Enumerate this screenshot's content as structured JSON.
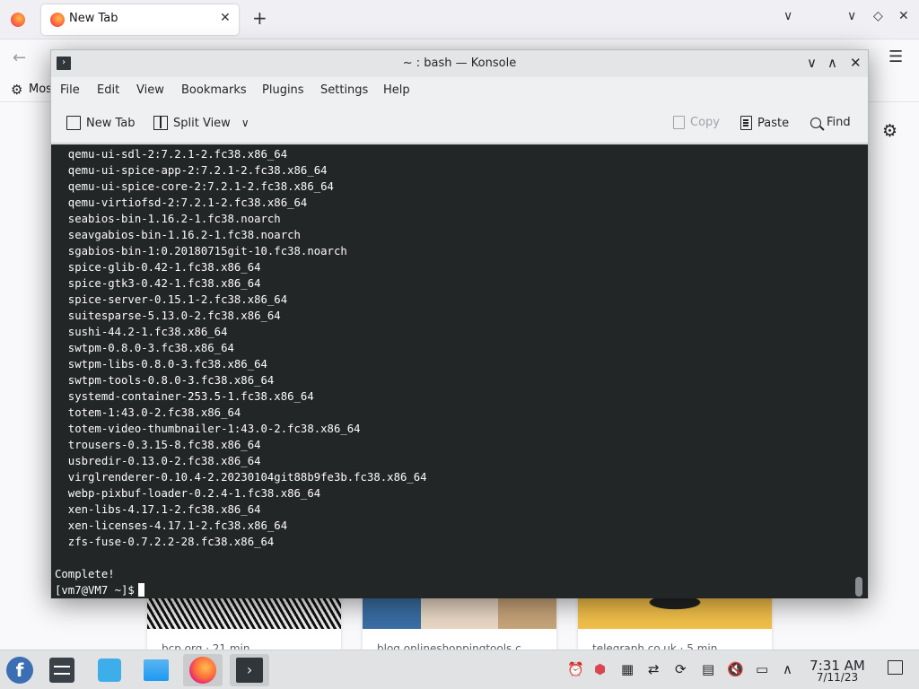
{
  "firefox": {
    "tab_title": "New Tab",
    "tab_close": "✕",
    "new_tab_symbol": "+",
    "list_tabs_symbol": "∨",
    "minimize_symbol": "∨",
    "maximize_symbol": "◇",
    "close_symbol": "✕",
    "back_symbol": "←",
    "menu_symbol": "☰",
    "bookmark_label": "Mos",
    "bookmark_icon": "gear-icon",
    "settings_symbol": "⚙",
    "cards": [
      {
        "text": "bcp.org · 21 min"
      },
      {
        "text": "blog.onlineshoppingtools.c..."
      },
      {
        "text": "telegraph.co.uk · 5 min"
      }
    ]
  },
  "konsole": {
    "title": "~ : bash — Konsole",
    "window_buttons": {
      "minimize": "∨",
      "maximize": "∧",
      "close": "✕"
    },
    "menu": [
      "File",
      "Edit",
      "View",
      "Bookmarks",
      "Plugins",
      "Settings",
      "Help"
    ],
    "toolbar": {
      "new_tab": "New Tab",
      "split_view": "Split View",
      "split_chevron": "∨",
      "copy": "Copy",
      "paste": "Paste",
      "find": "Find"
    },
    "terminal_lines": [
      "  qemu-ui-sdl-2:7.2.1-2.fc38.x86_64",
      "  qemu-ui-spice-app-2:7.2.1-2.fc38.x86_64",
      "  qemu-ui-spice-core-2:7.2.1-2.fc38.x86_64",
      "  qemu-virtiofsd-2:7.2.1-2.fc38.x86_64",
      "  seabios-bin-1.16.2-1.fc38.noarch",
      "  seavgabios-bin-1.16.2-1.fc38.noarch",
      "  sgabios-bin-1:0.20180715git-10.fc38.noarch",
      "  spice-glib-0.42-1.fc38.x86_64",
      "  spice-gtk3-0.42-1.fc38.x86_64",
      "  spice-server-0.15.1-2.fc38.x86_64",
      "  suitesparse-5.13.0-2.fc38.x86_64",
      "  sushi-44.2-1.fc38.x86_64",
      "  swtpm-0.8.0-3.fc38.x86_64",
      "  swtpm-libs-0.8.0-3.fc38.x86_64",
      "  swtpm-tools-0.8.0-3.fc38.x86_64",
      "  systemd-container-253.5-1.fc38.x86_64",
      "  totem-1:43.0-2.fc38.x86_64",
      "  totem-video-thumbnailer-1:43.0-2.fc38.x86_64",
      "  trousers-0.3.15-8.fc38.x86_64",
      "  usbredir-0.13.0-2.fc38.x86_64",
      "  virglrenderer-0.10.4-2.20230104git88b9fe3b.fc38.x86_64",
      "  webp-pixbuf-loader-0.2.4-1.fc38.x86_64",
      "  xen-libs-4.17.1-2.fc38.x86_64",
      "  xen-licenses-4.17.1-2.fc38.x86_64",
      "  zfs-fuse-0.7.2.2-28.fc38.x86_64",
      "",
      "Complete!"
    ],
    "prompt": "[vm7@VM7 ~]$"
  },
  "taskbar": {
    "launcher_symbol": "f",
    "konsole_symbol": "›",
    "tray_symbols": {
      "alarm": "⏰",
      "package": "⬢",
      "keyboard": "▦",
      "network_share": "⇄",
      "updates": "⟳",
      "clipboard": "▤",
      "volume": "🔇",
      "display": "▭",
      "expand": "∧"
    },
    "time": "7:31 AM",
    "date": "7/11/23"
  }
}
